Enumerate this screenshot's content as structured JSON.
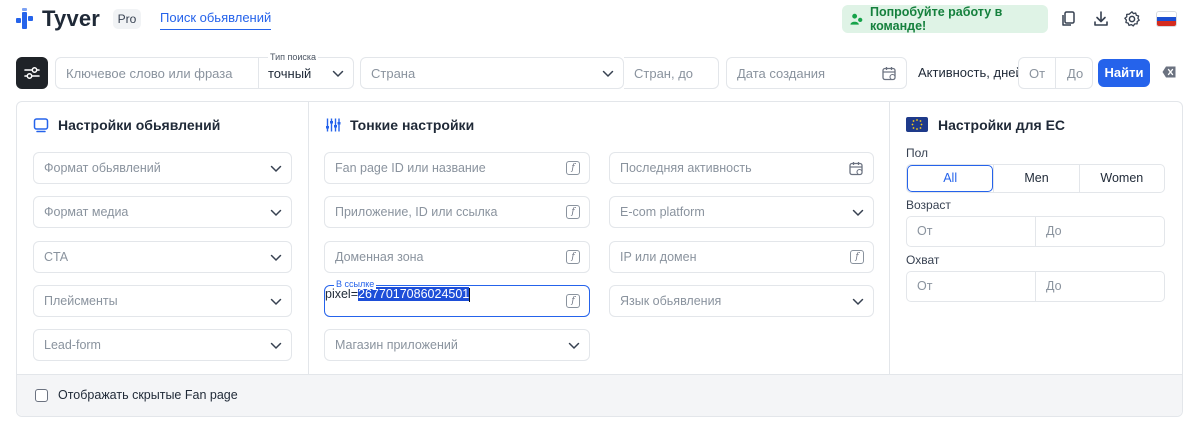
{
  "header": {
    "logo_text": "Tyver",
    "pro_badge": "Pro",
    "nav_link": "Поиск обьявлений",
    "team_button": "Попробуйте работу в команде!",
    "icons": [
      "copy-icon",
      "download-icon",
      "settings-icon",
      "russia-flag-icon"
    ]
  },
  "search": {
    "keyword_placeholder": "Ключевое слово или фраза",
    "search_type_label": "Тип поиска",
    "search_type_value": "точный",
    "country_placeholder": "Страна",
    "countries_to_placeholder": "Стран, до",
    "date_placeholder": "Дата создания",
    "activity_label": "Активность, дней",
    "activity_from": "От",
    "activity_to": "До",
    "find_button": "Найти"
  },
  "ads_settings": {
    "title": "Настройки обьявлений",
    "fields": [
      "Формат обьявлений",
      "Формат медиа",
      "CTA",
      "Плейсменты",
      "Lead-form"
    ]
  },
  "fine_settings": {
    "title": "Тонкие настройки",
    "col1": {
      "fanpage_placeholder": "Fan page ID или название",
      "app_placeholder": "Приложение, ID или ссылка",
      "domain_zone_placeholder": "Доменная зона",
      "link_label": "В ссылке",
      "link_prefix": "pixel=",
      "link_selected": "267701708602450",
      "link_tail": "1",
      "app_store_placeholder": "Магазин приложений"
    },
    "col2": {
      "last_activity_placeholder": "Последняя активность",
      "ecom_placeholder": "E-com platform",
      "ip_domain_placeholder": "IP или домен",
      "language_placeholder": "Язык обьявления"
    }
  },
  "eu_settings": {
    "title": "Настройки для ЕС",
    "gender_label": "Пол",
    "gender_options": [
      "All",
      "Men",
      "Women"
    ],
    "gender_selected": "All",
    "age_label": "Возраст",
    "age_from": "От",
    "age_to": "До",
    "reach_label": "Охват",
    "reach_from": "От",
    "reach_to": "До"
  },
  "footer": {
    "show_hidden_label": "Отображать скрытые Fan page",
    "show_hidden_checked": false
  },
  "colors": {
    "accent": "#2563eb",
    "team_bg": "#dff3e6",
    "team_text": "#15803d",
    "dark_button": "#1f2328"
  }
}
